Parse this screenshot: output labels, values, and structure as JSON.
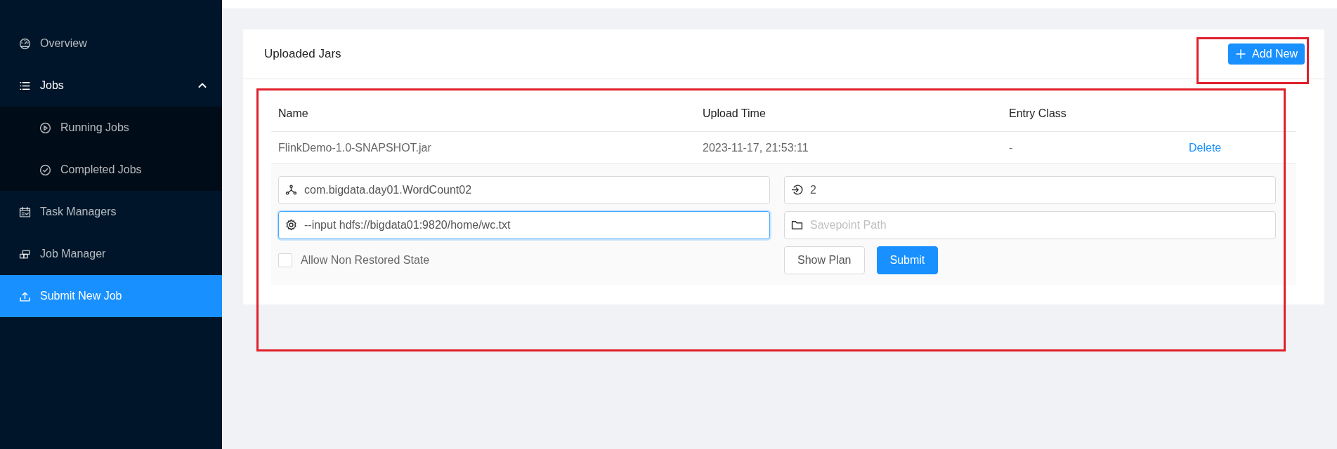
{
  "sidebar": {
    "items": [
      {
        "label": "Overview",
        "selected": false
      },
      {
        "label": "Jobs",
        "selected": false,
        "expanded": true,
        "children": [
          {
            "label": "Running Jobs",
            "selected": false
          },
          {
            "label": "Completed Jobs",
            "selected": false
          }
        ]
      },
      {
        "label": "Task Managers",
        "selected": false
      },
      {
        "label": "Job Manager",
        "selected": false
      },
      {
        "label": "Submit New Job",
        "selected": true
      }
    ]
  },
  "card": {
    "title": "Uploaded Jars",
    "add_button": {
      "label": "Add New"
    }
  },
  "table": {
    "columns": [
      "Name",
      "Upload Time",
      "Entry Class"
    ],
    "rows": [
      {
        "name": "FlinkDemo-1.0-SNAPSHOT.jar",
        "upload_time": "2023-11-17, 21:53:11",
        "entry_class": "-",
        "action": "Delete",
        "expanded": true,
        "form": {
          "fields": [
            {
              "value": "com.bigdata.day01.WordCount02",
              "focused": false
            },
            {
              "value": "2",
              "focused": false
            },
            {
              "value": "--input hdfs://bigdata01:9820/home/wc.txt",
              "focused": true
            },
            {
              "placeholder": "Savepoint Path",
              "focused": false
            }
          ],
          "checkbox": {
            "label": "Allow Non Restored State",
            "checked": false
          },
          "buttons": [
            {
              "label": "Show Plan",
              "kind": "default"
            },
            {
              "label": "Submit",
              "kind": "primary"
            }
          ]
        }
      }
    ]
  },
  "annotations": [
    {
      "kind": "highlight"
    },
    {
      "kind": "highlight"
    }
  ]
}
